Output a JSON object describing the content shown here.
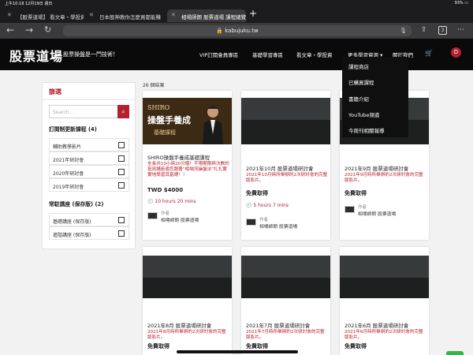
{
  "status_bar": {
    "time": "上午10:18  12月19日 週日",
    "battery": "93% ▭"
  },
  "tabs": [
    {
      "label": "【股票道場】 看文章・學投資",
      "active": false
    },
    {
      "label": "日本股神教你怎麼買都能賺",
      "active": false
    },
    {
      "label": "相場師朗 股票道場 課程總覽",
      "active": true
    }
  ],
  "browser": {
    "url": "kabujuku.tw",
    "tab_count": "3",
    "icons": [
      "back-arrow-icon",
      "forward-arrow-icon",
      "reload-icon",
      "lock-icon",
      "microphone-icon",
      "share-icon",
      "add-icon",
      "tabs-icon"
    ]
  },
  "site": {
    "logo": "股票道場",
    "slogan": "股票操盤是一門技術！",
    "nav": [
      "VIP訂閱會員專區",
      "基礎學習專區",
      "看文章・學投資",
      "更多學習資源 ▾",
      "關於我們"
    ],
    "user_initial": "D",
    "accent": "#b3202e"
  },
  "dropdown": [
    "課程商店",
    "已購買課程",
    "書籍介紹",
    "YouTube頻道",
    "今周刊相關報導"
  ],
  "sidebar": {
    "title": "篩選",
    "search_placeholder": "Search...",
    "group1": {
      "title": "訂閱制更新課程 (4)",
      "items": [
        "輔助教學影片",
        "2021年研討會",
        "2020年研討會",
        "2019年研討會"
      ]
    },
    "group2": {
      "title": "常駐講座 (保存版) (2)",
      "items": [
        "基礎講座 (保存版)",
        "進階講座 (保存版)"
      ]
    }
  },
  "results_count": "26 個結果",
  "cards": [
    {
      "thumb_line1": "SHIRO",
      "thumb_line2": "操盤手養成",
      "thumb_line3": "基礎課程",
      "title": "SHIRO操盤手養成基礎課程",
      "desc": "全長共10小時20分鐘！不限期限與次數的投資講座適您跟著“相場流操盤法”扎扎實實地學習其基礎！！",
      "price": "TWD $4000",
      "time": "🕘 10 hours 20 mins",
      "author_label": "作者",
      "author": "相場師朗 股票道場"
    },
    {
      "title": "2021年10月 股票道場研討會",
      "desc": "2021年10月時所舉辦的2次研討會的完整版影片。",
      "price": "免費取得",
      "time": "🕘 5 hours 7 mins",
      "author_label": "作者",
      "author": "相場師朗 股票道場"
    },
    {
      "title": "2021年9月 股票道場研討會",
      "desc": "2021年9月時所舉辦的2次研討會的完整版影片。",
      "price": "免費取得",
      "author_label": "作者",
      "author": "相場師朗 股票道場"
    },
    {
      "title": "2021年8月 股票道場研討會",
      "desc": "2021年8月時所舉辦的2次研討會的完整版影片。",
      "price": "免費取得"
    },
    {
      "title": "2021年7月 股票道場研討會",
      "desc": "2021年7月時所舉辦的2次研討會的完整版影片。",
      "price": "免費取得"
    },
    {
      "title": "2021年6月 股票道場研討會",
      "desc": "2021年6月時所舉辦的2次研討會的完整版影片。",
      "price": "免費取得"
    }
  ]
}
